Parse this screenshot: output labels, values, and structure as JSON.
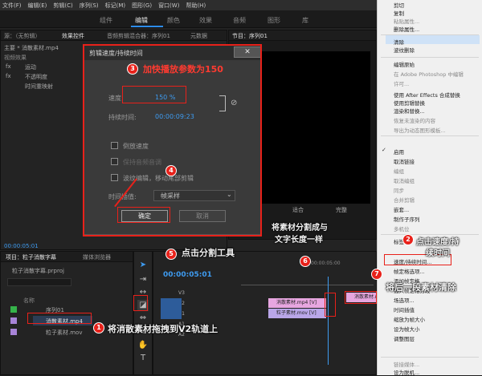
{
  "menu": [
    "文件(F)",
    "编辑(E)",
    "剪辑(C)",
    "序列(S)",
    "标记(M)",
    "图形(G)",
    "窗口(W)",
    "帮助(H)"
  ],
  "workspaces": [
    "组件",
    "编辑",
    "颜色",
    "效果",
    "音频",
    "图形",
    "库"
  ],
  "source_panel": {
    "tab_source": "源：（无剪辑）",
    "tab_effects": "效果控件",
    "tab_audio": "音频剪辑混合器：序列01",
    "tab_meta": "元数据",
    "master": "主要 * 消散素材.mp4",
    "video_effects": "视频效果",
    "effects": [
      "运动",
      "不透明度",
      "时间重映射"
    ],
    "timecode": "00:00:05:01"
  },
  "program_panel": {
    "tab": "节目：序列01",
    "fit": "适合",
    "full": "完整"
  },
  "project_panel": {
    "tab_project": "项目：粒子消散字幕",
    "tab_media": "媒体浏览器",
    "file": "粒子消散字幕.prproj",
    "col_name": "名称",
    "items": [
      "序列01",
      "消散素材.mp4",
      "粒子素材.mov"
    ]
  },
  "timeline": {
    "timecode": "00:00:05:01",
    "ruler": "00:00:05:00",
    "tracks": [
      "V3",
      "V2",
      "V1",
      "A1",
      "A2"
    ],
    "clip_v2": "消散素材.mp4 [V]",
    "clip_v2b": "消散素材.mp4 [V]",
    "clip_v1": "粒子素材.mov [V]"
  },
  "dialog": {
    "title": "剪辑速度/持续时间",
    "speed_label": "速度:",
    "speed_value": "150 %",
    "duration_label": "持续时间:",
    "duration_value": "00:00:09:23",
    "reverse": "倒放速度",
    "keep_pitch": "保持音频音调",
    "ripple": "波纹编辑，移动尾部剪辑",
    "interp_label": "时间插值:",
    "interp_value": "帧采样",
    "ok": "确定",
    "cancel": "取消",
    "close": "✕"
  },
  "context_menu": [
    {
      "label": "剪切",
      "dis": false
    },
    {
      "label": "复制",
      "dis": false
    },
    {
      "label": "粘贴属性...",
      "dis": true
    },
    {
      "label": "删除属性...",
      "dis": false
    },
    {
      "label": "清除",
      "dis": false
    },
    {
      "label": "波纹删除",
      "dis": false
    },
    {
      "label": "编辑原始",
      "dis": false
    },
    {
      "label": "在 Adobe Photoshop 中编辑",
      "dis": true
    },
    {
      "label": "许可...",
      "dis": true
    },
    {
      "label": "使用 After Effects 合成替换",
      "dis": false
    },
    {
      "label": "使用剪辑替换",
      "dis": false
    },
    {
      "label": "渲染和替换...",
      "dis": false
    },
    {
      "label": "恢复未渲染的内容",
      "dis": true
    },
    {
      "label": "导出为动态图形模板...",
      "dis": true
    },
    {
      "label": "启用",
      "dis": false
    },
    {
      "label": "取消链接",
      "dis": false
    },
    {
      "label": "编组",
      "dis": true
    },
    {
      "label": "取消编组",
      "dis": true
    },
    {
      "label": "同步",
      "dis": true
    },
    {
      "label": "合并剪辑",
      "dis": true
    },
    {
      "label": "嵌套...",
      "dis": false
    },
    {
      "label": "制作子序列",
      "dis": false
    },
    {
      "label": "多机位",
      "dis": true
    },
    {
      "label": "标签",
      "dis": false
    },
    {
      "label": "速度/持续时间...",
      "dis": false
    },
    {
      "label": "帧定格选项...",
      "dis": false
    },
    {
      "label": "添加帧定格",
      "dis": false
    },
    {
      "label": "插入帧定格分段",
      "dis": false
    },
    {
      "label": "场选项...",
      "dis": false
    },
    {
      "label": "时间插值",
      "dis": false
    },
    {
      "label": "缩放为帧大小",
      "dis": false
    },
    {
      "label": "设为帧大小",
      "dis": false
    },
    {
      "label": "调整图层",
      "dis": false
    },
    {
      "label": "链接媒体...",
      "dis": true
    },
    {
      "label": "设为脱机...",
      "dis": false
    }
  ],
  "annotations": {
    "a1": "将消散素材拖拽到V2轨道上",
    "a2": "点击速度/持续时间",
    "a3": "加快播放参数为150",
    "a4": "",
    "a5": "点击分割工具",
    "a6": "将素材分割成与文字长度一样",
    "a7": "将后一段素材清除"
  },
  "colors": {
    "highlight": "#e8211a",
    "accent": "#2d8ceb",
    "clip_pink": "#e7a6e0",
    "clip_purple": "#b9a6e8",
    "context_bg": "#f0f0f0"
  }
}
